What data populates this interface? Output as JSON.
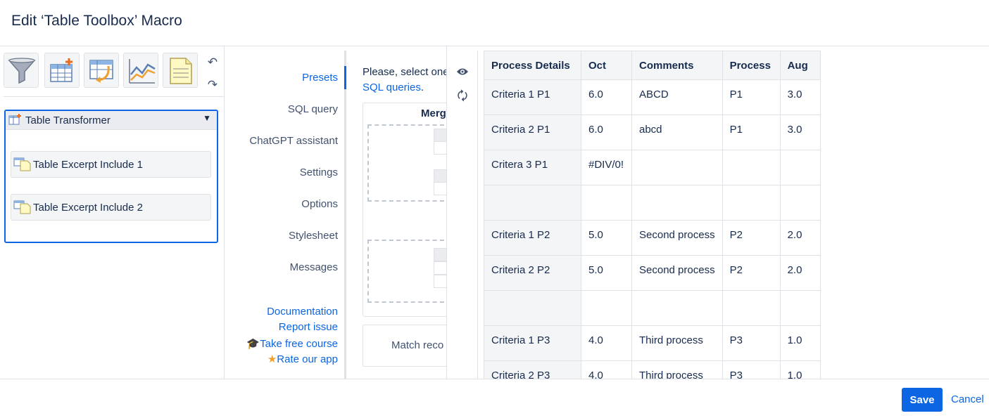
{
  "dialog": {
    "title": "Edit ‘Table Toolbox’ Macro"
  },
  "toolbar": {
    "buttons": [
      {
        "icon": "filter-funnel-icon"
      },
      {
        "icon": "table-add-icon"
      },
      {
        "icon": "table-transform-icon"
      },
      {
        "icon": "chart-line-icon"
      },
      {
        "icon": "table-excerpt-icon"
      }
    ],
    "undo_icon": "undo-icon",
    "redo_icon": "redo-icon"
  },
  "tree": {
    "root": "Table Transformer",
    "children": [
      "Table Excerpt Include 1",
      "Table Excerpt Include 2"
    ]
  },
  "nav": {
    "items": [
      "Presets",
      "SQL query",
      "ChatGPT assistant",
      "Settings",
      "Options",
      "Stylesheet",
      "Messages"
    ],
    "active": "Presets",
    "links": [
      "Documentation",
      "Report issue",
      "Take free course",
      "Rate our app"
    ]
  },
  "presets": {
    "intro": "Please, select one",
    "link": "SQL queries",
    "link_suffix": ".",
    "merge_title": "Merg",
    "match_label": "Match reco"
  },
  "preview": {
    "icons": [
      "eye-icon",
      "refresh-icon"
    ],
    "columns": [
      "Process Details",
      "Oct",
      "Comments",
      "Process",
      "Aug"
    ],
    "rows": [
      [
        "Criteria 1 P1",
        "6.0",
        "ABCD",
        "P1",
        "3.0"
      ],
      [
        "Criteria 2 P1",
        "6.0",
        "abcd",
        "P1",
        "3.0"
      ],
      [
        "Critera 3 P1",
        "#DIV/0!",
        "",
        "",
        ""
      ],
      [
        "",
        "",
        "",
        "",
        ""
      ],
      [
        "Criteria 1 P2",
        "5.0",
        "Second process",
        "P2",
        "2.0"
      ],
      [
        "Criteria 2 P2",
        "5.0",
        "Second process",
        "P2",
        "2.0"
      ],
      [
        "",
        "",
        "",
        "",
        ""
      ],
      [
        "Criteria 1 P3",
        "4.0",
        "Third process",
        "P3",
        "1.0"
      ],
      [
        "Criteria 2 P3",
        "4.0",
        "Third process",
        "P3",
        "1.0"
      ]
    ]
  },
  "footer": {
    "save": "Save",
    "cancel": "Cancel"
  }
}
